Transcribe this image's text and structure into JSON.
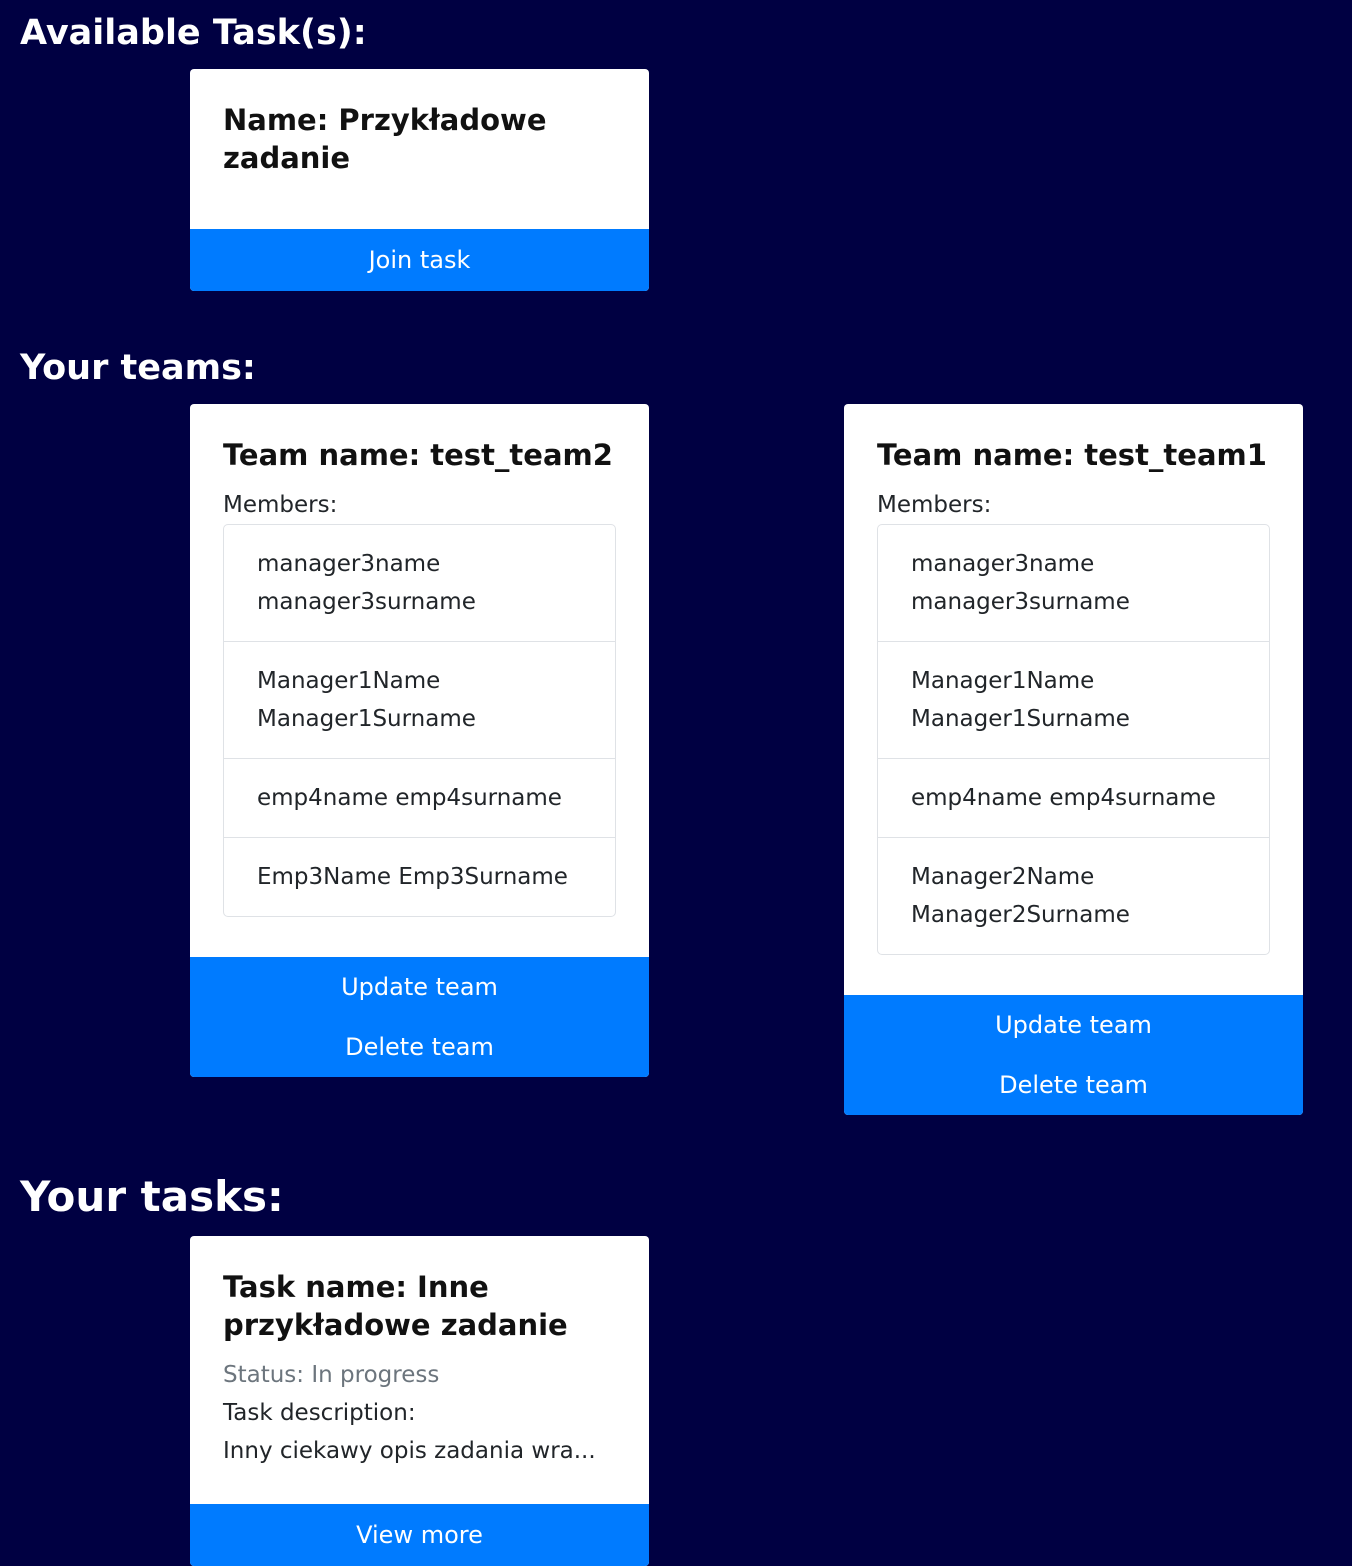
{
  "sections": {
    "available": "Available Task(s):",
    "teams": "Your teams:",
    "tasks": "Your tasks:"
  },
  "available_tasks": [
    {
      "name": "Name: Przykładowe zadanie",
      "button": "Join task"
    }
  ],
  "teams": [
    {
      "title": "Team name: test_team2",
      "members_label": "Members:",
      "members": [
        "manager3name manager3surname",
        "Manager1Name Manager1Surname",
        "emp4name emp4surname",
        "Emp3Name Emp3Surname"
      ],
      "update_label": "Update team",
      "delete_label": "Delete team"
    },
    {
      "title": "Team name: test_team1",
      "members_label": "Members:",
      "members": [
        "manager3name manager3surname",
        "Manager1Name Manager1Surname",
        "emp4name emp4surname",
        "Manager2Name Manager2Surname"
      ],
      "update_label": "Update team",
      "delete_label": "Delete team"
    }
  ],
  "your_tasks": [
    {
      "title": "Task name: Inne przykładowe zadanie",
      "status": "Status: In progress",
      "desc_label": "Task description:",
      "desc": "Inny ciekawy opis zadania wra...",
      "button": "View more"
    }
  ],
  "colors": {
    "background": "#000042",
    "primary": "#007bff",
    "muted": "#6c757d"
  }
}
